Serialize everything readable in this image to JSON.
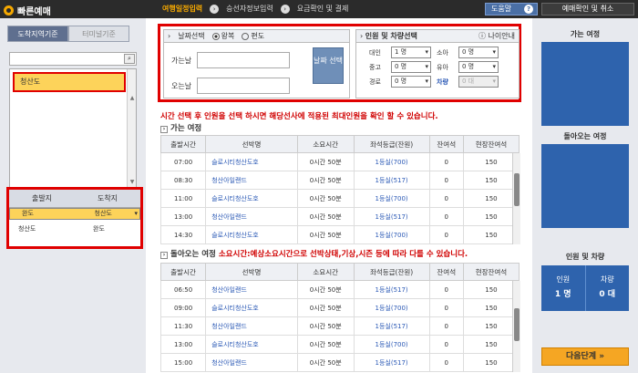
{
  "app": {
    "title": "빠른예매"
  },
  "steps": [
    {
      "label": "여행일정입력"
    },
    {
      "label": "승선자정보입력"
    },
    {
      "label": "요금확인 및 결제"
    }
  ],
  "top_buttons": {
    "help": "도움말",
    "help_icon": "?",
    "reservation": "예매확인 및 취소"
  },
  "left": {
    "tabs": [
      "도착지역기준",
      "터미널기준"
    ],
    "search_icon": "magnifier-icon",
    "regions": [
      "청산도"
    ],
    "route_headers": [
      "출발지",
      "도착지"
    ],
    "routes": [
      {
        "from": "완도",
        "to": "청산도",
        "selected": true
      },
      {
        "from": "청산도",
        "to": "완도",
        "selected": false
      }
    ]
  },
  "date_panel": {
    "title": "날짜선택",
    "trip_types": [
      "왕복",
      "편도"
    ],
    "depart_label": "가는날",
    "return_label": "오는날",
    "select_button": "날짜 선택"
  },
  "pax_panel": {
    "title": "인원 및 차량선택",
    "age_link": "나이안내",
    "rows": [
      {
        "label1": "대인",
        "value1": "1 명",
        "label2": "소아",
        "value2": "0 명"
      },
      {
        "label1": "중고",
        "value1": "0 명",
        "label2": "유아",
        "value2": "0 명"
      },
      {
        "label1": "경로",
        "value1": "0 명",
        "label2": "차량",
        "value2": "0 대"
      }
    ]
  },
  "notice": "시간 선택 후 인원을 선택 하시면 해당선사에 적용된 최대인원을 확인 할 수 있습니다.",
  "outbound": {
    "title": "가는 여정",
    "headers": [
      "출발시간",
      "선박명",
      "소요시간",
      "좌석등급(잔원)",
      "잔여석",
      "현장잔여석"
    ],
    "rows": [
      [
        "07:00",
        "슬로시티청산도호",
        "0시간 50분",
        "1등실(700)",
        "0",
        "150"
      ],
      [
        "08:30",
        "청산아일랜드",
        "0시간 50분",
        "1등실(517)",
        "0",
        "150"
      ],
      [
        "11:00",
        "슬로시티청산도호",
        "0시간 50분",
        "1등실(700)",
        "0",
        "150"
      ],
      [
        "13:00",
        "청산아일랜드",
        "0시간 50분",
        "1등실(517)",
        "0",
        "150"
      ],
      [
        "14:30",
        "슬로시티청산도호",
        "0시간 50분",
        "1등실(700)",
        "0",
        "150"
      ]
    ]
  },
  "return": {
    "title": "돌아오는 여정",
    "note": "소요시간:예상소요시간으로 선박상태,기상,시즌 등에 따라 다를 수 있습니다.",
    "headers": [
      "출발시간",
      "선박명",
      "소요시간",
      "좌석등급(잔원)",
      "잔여석",
      "현장잔여석"
    ],
    "rows": [
      [
        "06:50",
        "청산아일랜드",
        "0시간 50분",
        "1등실(517)",
        "0",
        "150"
      ],
      [
        "09:00",
        "슬로시티청산도호",
        "0시간 50분",
        "1등실(700)",
        "0",
        "150"
      ],
      [
        "11:30",
        "청산아일랜드",
        "0시간 50분",
        "1등실(517)",
        "0",
        "150"
      ],
      [
        "13:00",
        "슬로시티청산도호",
        "0시간 50분",
        "1등실(700)",
        "0",
        "150"
      ],
      [
        "15:00",
        "청산아일랜드",
        "0시간 50분",
        "1등실(517)",
        "0",
        "150"
      ]
    ]
  },
  "summary": {
    "outbound_title": "가는 여정",
    "return_title": "돌아오는 여정",
    "pax_title": "인원 및 차량",
    "pax_label": "인원",
    "pax_value": "1 명",
    "vehicle_label": "차량",
    "vehicle_value": "0 대",
    "next_button": "다음단계 »"
  }
}
